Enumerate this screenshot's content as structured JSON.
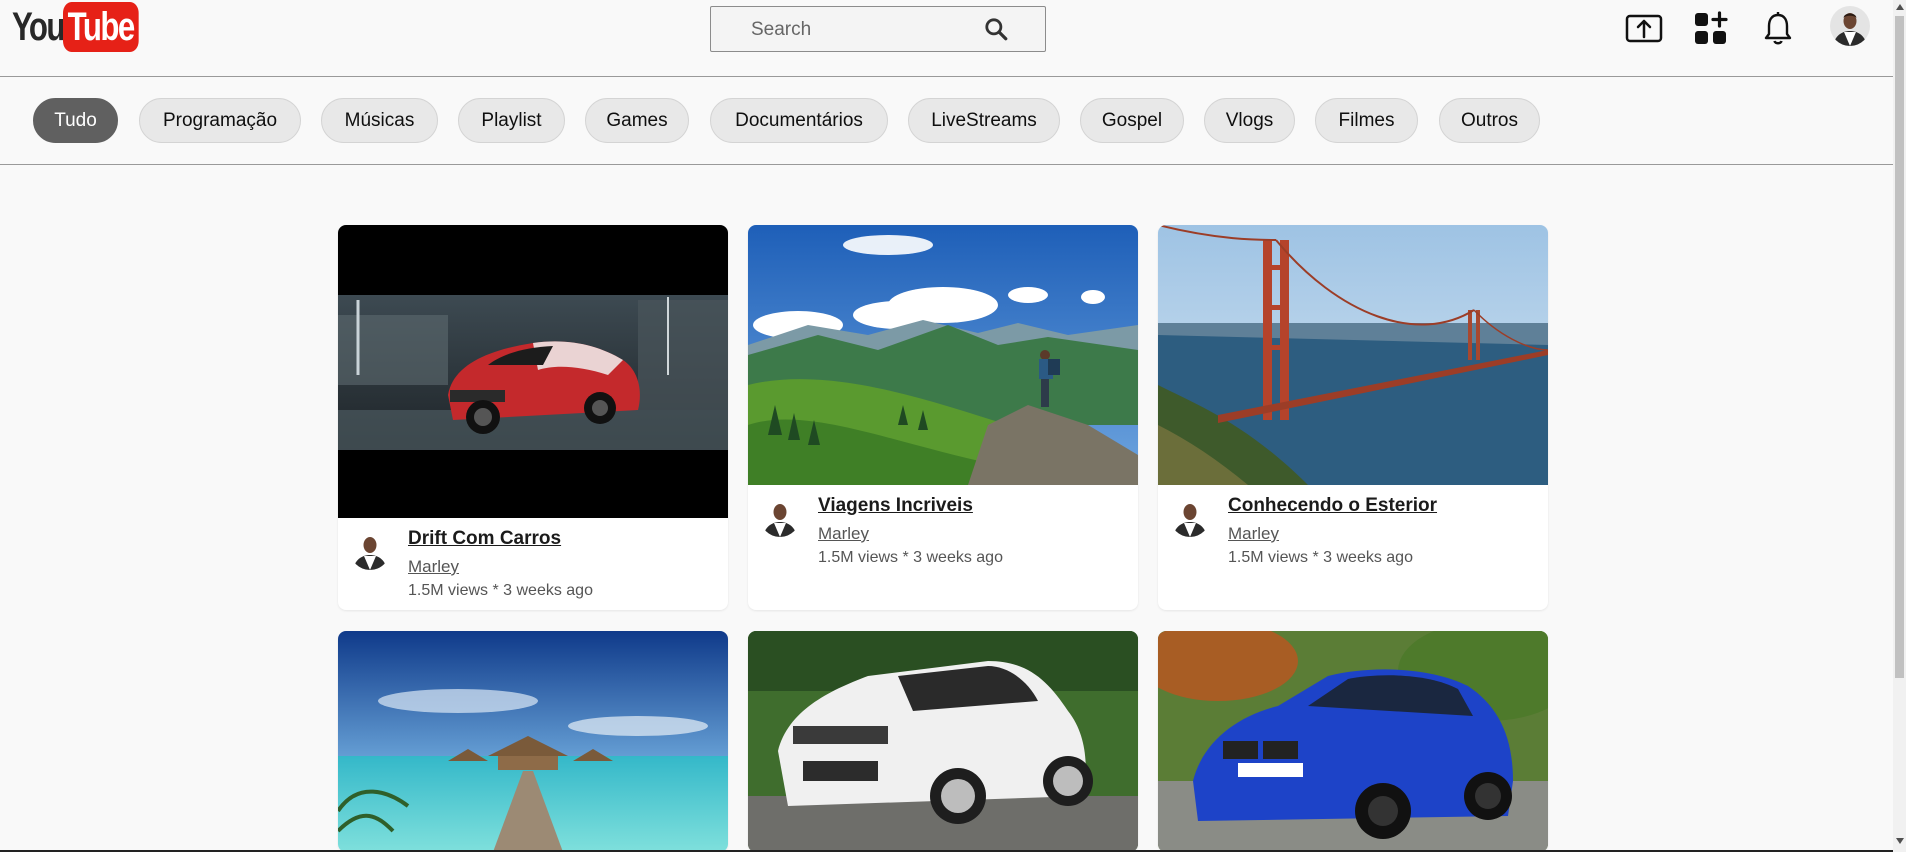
{
  "header": {
    "logo": {
      "part1": "You",
      "part2": "Tube"
    },
    "search": {
      "placeholder": "Search",
      "icon": "search-icon"
    },
    "icons": [
      "upload-icon",
      "apps-add-icon",
      "bell-icon",
      "avatar"
    ]
  },
  "chips": [
    {
      "label": "Tudo",
      "active": true
    },
    {
      "label": "Programação"
    },
    {
      "label": "Músicas"
    },
    {
      "label": "Playlist"
    },
    {
      "label": "Games"
    },
    {
      "label": "Documentários"
    },
    {
      "label": "LiveStreams"
    },
    {
      "label": "Gospel"
    },
    {
      "label": "Vlogs"
    },
    {
      "label": "Filmes"
    },
    {
      "label": "Outros"
    }
  ],
  "videos": [
    {
      "title": "Drift Com Carros",
      "channel": "Marley",
      "stats": "1.5M views * 3 weeks ago",
      "thumbnail": "red-car-night-street"
    },
    {
      "title": "Viagens Incriveis",
      "channel": "Marley",
      "stats": "1.5M views * 3 weeks ago",
      "thumbnail": "hiker-on-mountain"
    },
    {
      "title": "Conhecendo o Esterior",
      "channel": "Marley",
      "stats": "1.5M views * 3 weeks ago",
      "thumbnail": "golden-gate-bridge"
    },
    {
      "thumbnail": "tropical-pier-bungalows"
    },
    {
      "thumbnail": "white-suv"
    },
    {
      "thumbnail": "blue-sedan"
    }
  ],
  "colors": {
    "logo_red": "#e62117",
    "active_chip": "#606060",
    "chip_bg": "#e8e8e8",
    "page_bg": "#f9f9f9"
  }
}
